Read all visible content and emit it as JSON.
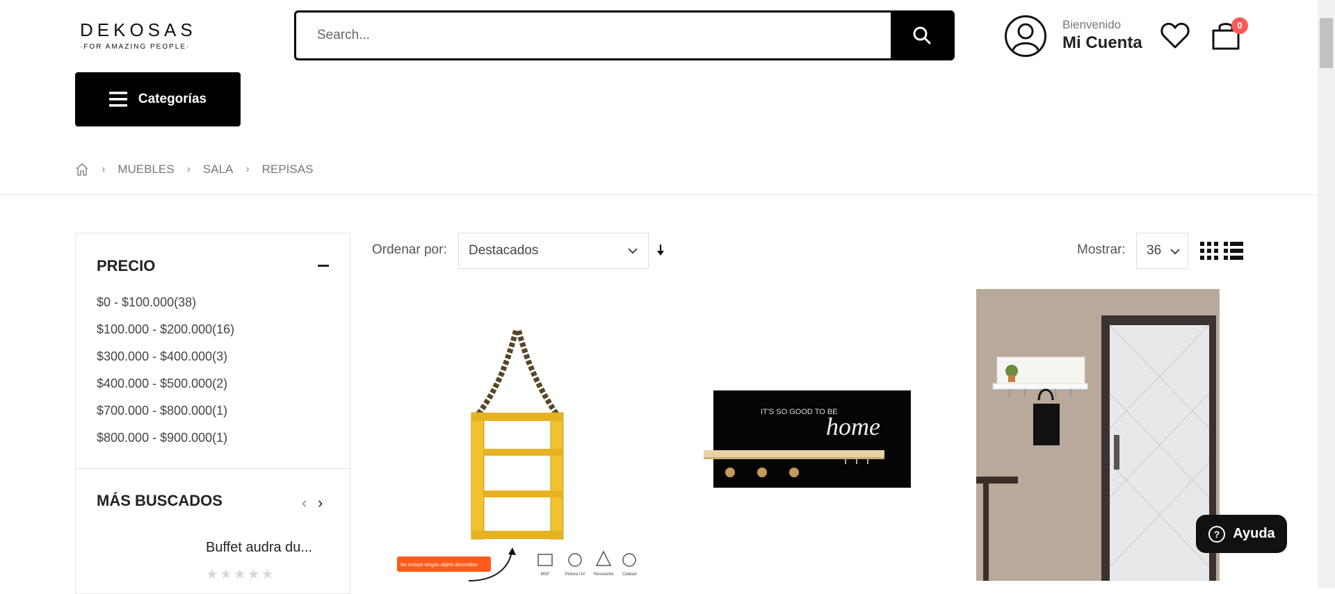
{
  "brand": {
    "name": "DEKOSAS",
    "tagline": "·FOR AMAZING PEOPLE·"
  },
  "search": {
    "placeholder": "Search..."
  },
  "account": {
    "welcome": "Bienvenido",
    "label": "Mi Cuenta"
  },
  "cart": {
    "count": "0"
  },
  "categories_button": "Categorías",
  "breadcrumb": [
    "MUEBLES",
    "SALA",
    "REPISAS"
  ],
  "filters": {
    "price_title": "PRECIO",
    "price_ranges": [
      "$0 - $100.000(38)",
      "$100.000 - $200.000(16)",
      "$300.000 - $400.000(3)",
      "$400.000 - $500.000(2)",
      "$700.000 - $800.000(1)",
      "$800.000 - $900.000(1)"
    ],
    "mas_buscados_title": "MÁS BUSCADOS",
    "mas_buscados_item": "Buffet audra du..."
  },
  "toolbar": {
    "sort_label": "Ordenar por:",
    "sort_value": "Destacados",
    "show_label": "Mostrar:",
    "show_value": "36"
  },
  "products": [
    {
      "image": "yellow-rope-shelf",
      "badge_text": "No incluye ningún objeto decorativo",
      "feature_labels": [
        "MDF",
        "Pintura UV",
        "Resistente",
        "Calidad"
      ]
    },
    {
      "image": "home-wall-shelf",
      "art_text": "IT'S SO GOOD TO BE",
      "art_script": "home"
    },
    {
      "image": "entry-key-holder"
    }
  ],
  "help_button": "Ayuda",
  "colors": {
    "primary": "#000000",
    "badge": "#ff5a5a",
    "shelf_yellow": "#f2c12e"
  }
}
